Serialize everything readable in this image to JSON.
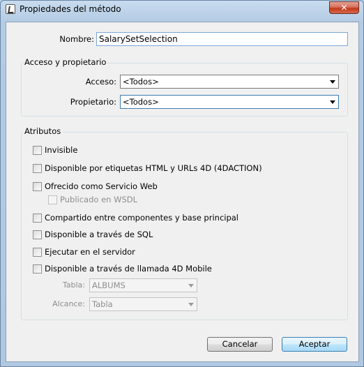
{
  "window": {
    "title": "Propiedades del método",
    "close_glyph": "✕"
  },
  "name_field": {
    "label": "Nombre:",
    "value": "SalarySetSelection"
  },
  "access_group": {
    "legend": "Acceso y propietario",
    "access_label": "Acceso:",
    "access_value": "<Todos>",
    "owner_label": "Propietario:",
    "owner_value": "<Todos>"
  },
  "attributes": {
    "legend": "Atributos",
    "invisible": "Invisible",
    "html_tags": "Disponible por etiquetas HTML y URLs 4D (4DACTION)",
    "web_service": "Ofrecido como Servicio Web",
    "wsdl": "Publicado en WSDL",
    "shared": "Compartido entre componentes y base principal",
    "sql": "Disponible a través de SQL",
    "server": "Ejecutar en el servidor",
    "mobile": "Disponible a través de llamada 4D Mobile",
    "table_label": "Tabla:",
    "table_value": "ALBUMS",
    "scope_label": "Alcance:",
    "scope_value": "Tabla"
  },
  "buttons": {
    "cancel": "Cancelar",
    "accept": "Aceptar"
  },
  "icons": {
    "app": "4d-method-icon",
    "close": "close-icon",
    "dropdown": "chevron-down-icon"
  }
}
